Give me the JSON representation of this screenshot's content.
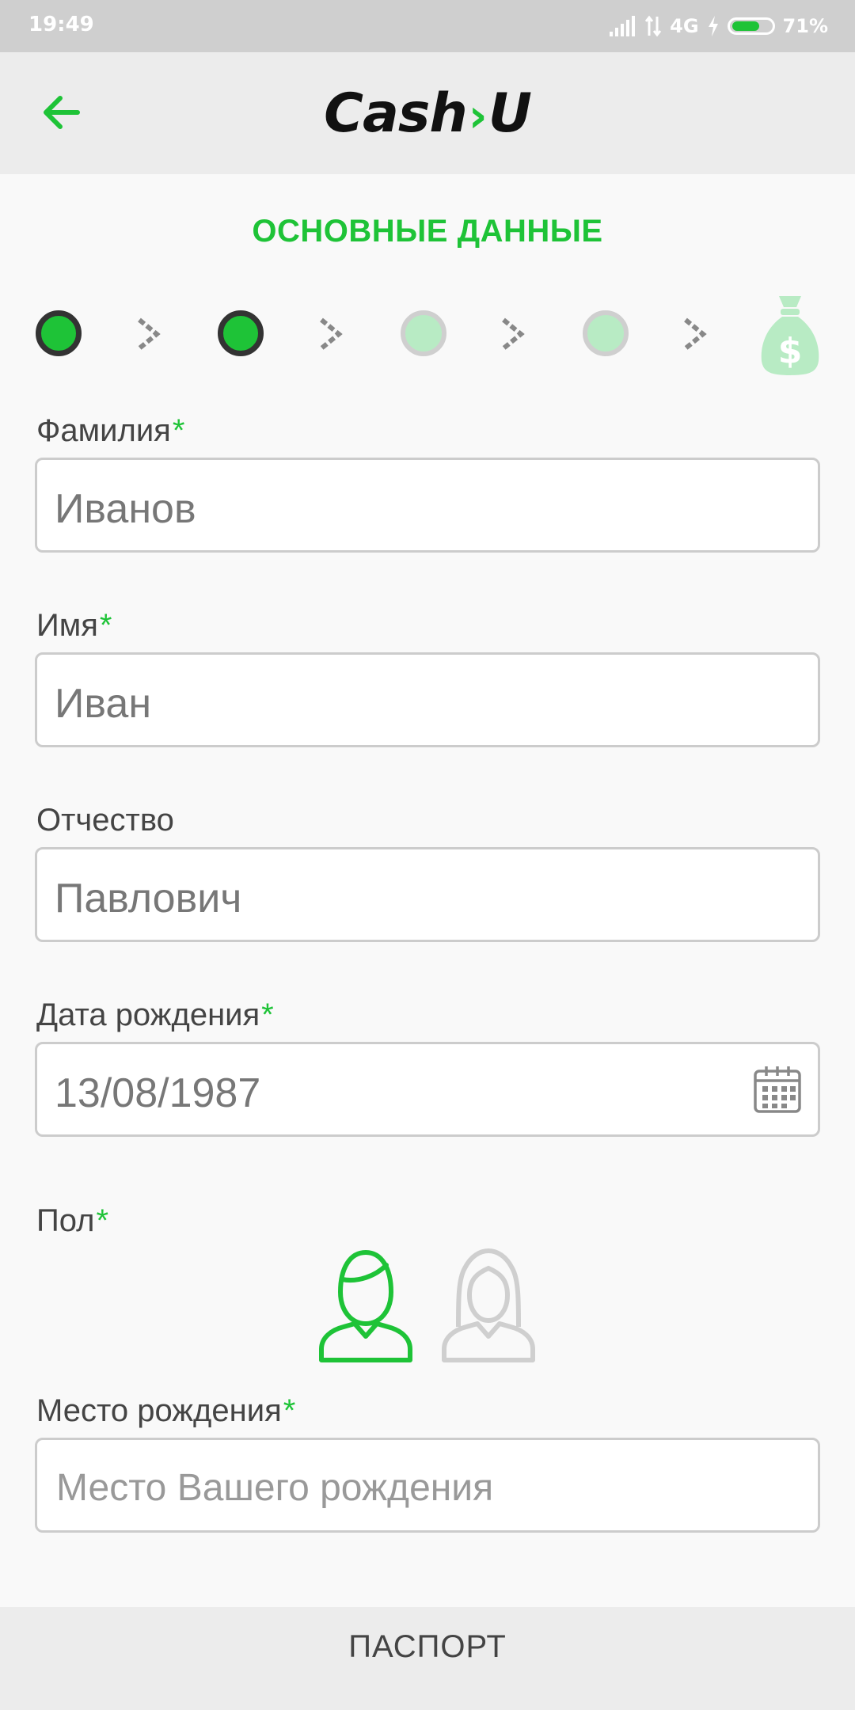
{
  "status_bar": {
    "time": "19:49",
    "network": "4G",
    "battery": "71%",
    "battery_level": 0.71
  },
  "app_bar": {
    "logo_left": "Cash",
    "logo_right": "U",
    "back_icon": "arrow-left-icon"
  },
  "section_title": "ОСНОВНЫЕ ДАННЫЕ",
  "progress": {
    "steps_total": 4,
    "steps_done": 2,
    "final_icon": "money-bag-icon"
  },
  "form": {
    "last_name": {
      "label": "Фамилия",
      "required": "*",
      "value": "Иванов"
    },
    "first_name": {
      "label": "Имя",
      "required": "*",
      "value": "Иван"
    },
    "patronymic": {
      "label": "Отчество",
      "value": "Павлович"
    },
    "birth_date": {
      "label": "Дата рождения",
      "required": "*",
      "value": "13/08/1987",
      "icon": "calendar-icon"
    },
    "gender": {
      "label": "Пол",
      "required": "*",
      "selected": "male"
    },
    "birth_place": {
      "label": "Место рождения",
      "required": "*",
      "placeholder": "Место Вашего рождения"
    }
  },
  "bottom_bar": {
    "label": "ПАСПОРТ"
  },
  "colors": {
    "accent": "#1ec337",
    "accent_light": "#b8ebc4",
    "text": "#444444",
    "border": "#cccccc"
  }
}
